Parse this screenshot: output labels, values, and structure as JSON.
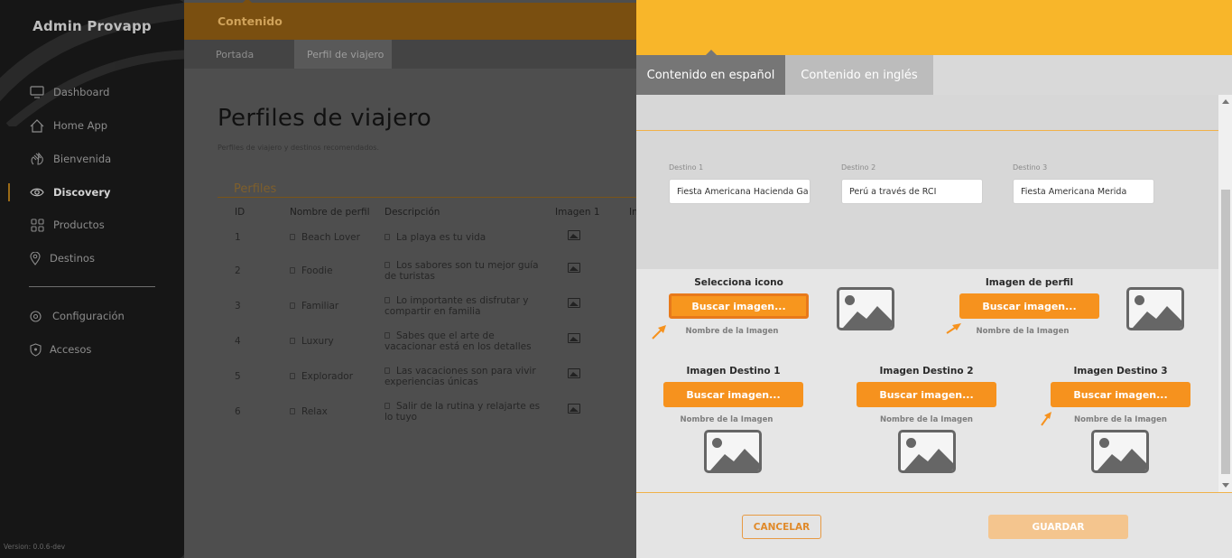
{
  "sidebar": {
    "brand": "Admin Provapp",
    "items": [
      {
        "label": "Dashboard",
        "icon": "monitor-icon"
      },
      {
        "label": "Home App",
        "icon": "home-icon"
      },
      {
        "label": "Bienvenida",
        "icon": "wave-hand-icon"
      },
      {
        "label": "Discovery",
        "icon": "eye-icon",
        "active": true
      },
      {
        "label": "Productos",
        "icon": "grid-icon"
      },
      {
        "label": "Destinos",
        "icon": "map-pin-icon"
      },
      {
        "label": "Configuración",
        "icon": "gear-icon"
      },
      {
        "label": "Accesos",
        "icon": "shield-icon"
      }
    ],
    "version": "Version: 0.0.6-dev"
  },
  "main": {
    "topbar_title": "Contenido",
    "subtabs": [
      "Portada",
      "Perfil de viajero"
    ],
    "page_title": "Perfiles de viajero",
    "page_subtitle": "Perfiles de viajero y destinos recomendados.",
    "section_title": "Perfiles",
    "table": {
      "headers": [
        "ID",
        "Nombre de perfil",
        "Descripción",
        "Imagen 1",
        "Im"
      ],
      "rows": [
        {
          "id": "1",
          "name": "Beach Lover",
          "desc": "La playa es tu vida"
        },
        {
          "id": "2",
          "name": "Foodie",
          "desc": "Los sabores son tu mejor guía de turistas"
        },
        {
          "id": "3",
          "name": "Familiar",
          "desc": "Lo importante es disfrutar y compartir en familia"
        },
        {
          "id": "4",
          "name": "Luxury",
          "desc": "Sabes que el arte de vacacionar está en los detalles"
        },
        {
          "id": "5",
          "name": "Explorador",
          "desc": "Las vacaciones son para vivir experiencias únicas"
        },
        {
          "id": "6",
          "name": "Relax",
          "desc": "Salir de la rutina y relajarte es lo tuyo"
        }
      ]
    }
  },
  "panel": {
    "tabs": [
      "Contenido en español",
      "Contenido en inglés"
    ],
    "destinos": [
      {
        "label": "Destino 1",
        "value": "Fiesta Americana Hacienda Ga"
      },
      {
        "label": "Destino 2",
        "value": "Perú a través de RCI"
      },
      {
        "label": "Destino 3",
        "value": "Fiesta Americana Merida"
      }
    ],
    "uploads": {
      "icono_title": "Selecciona icono",
      "perfil_title": "Imagen de perfil",
      "destino1_title": "Imagen Destino 1",
      "destino2_title": "Imagen Destino 2",
      "destino3_title": "Imagen Destino 3",
      "buscar_label": "Buscar imagen...",
      "nombre_label": "Nombre de la Imagen"
    },
    "footer": {
      "cancel_label": "CANCELAR",
      "save_label": "GUARDAR"
    },
    "colors": {
      "header": "#f8b62a",
      "accent": "#f6921e",
      "save_disabled": "#f4c58e"
    }
  }
}
